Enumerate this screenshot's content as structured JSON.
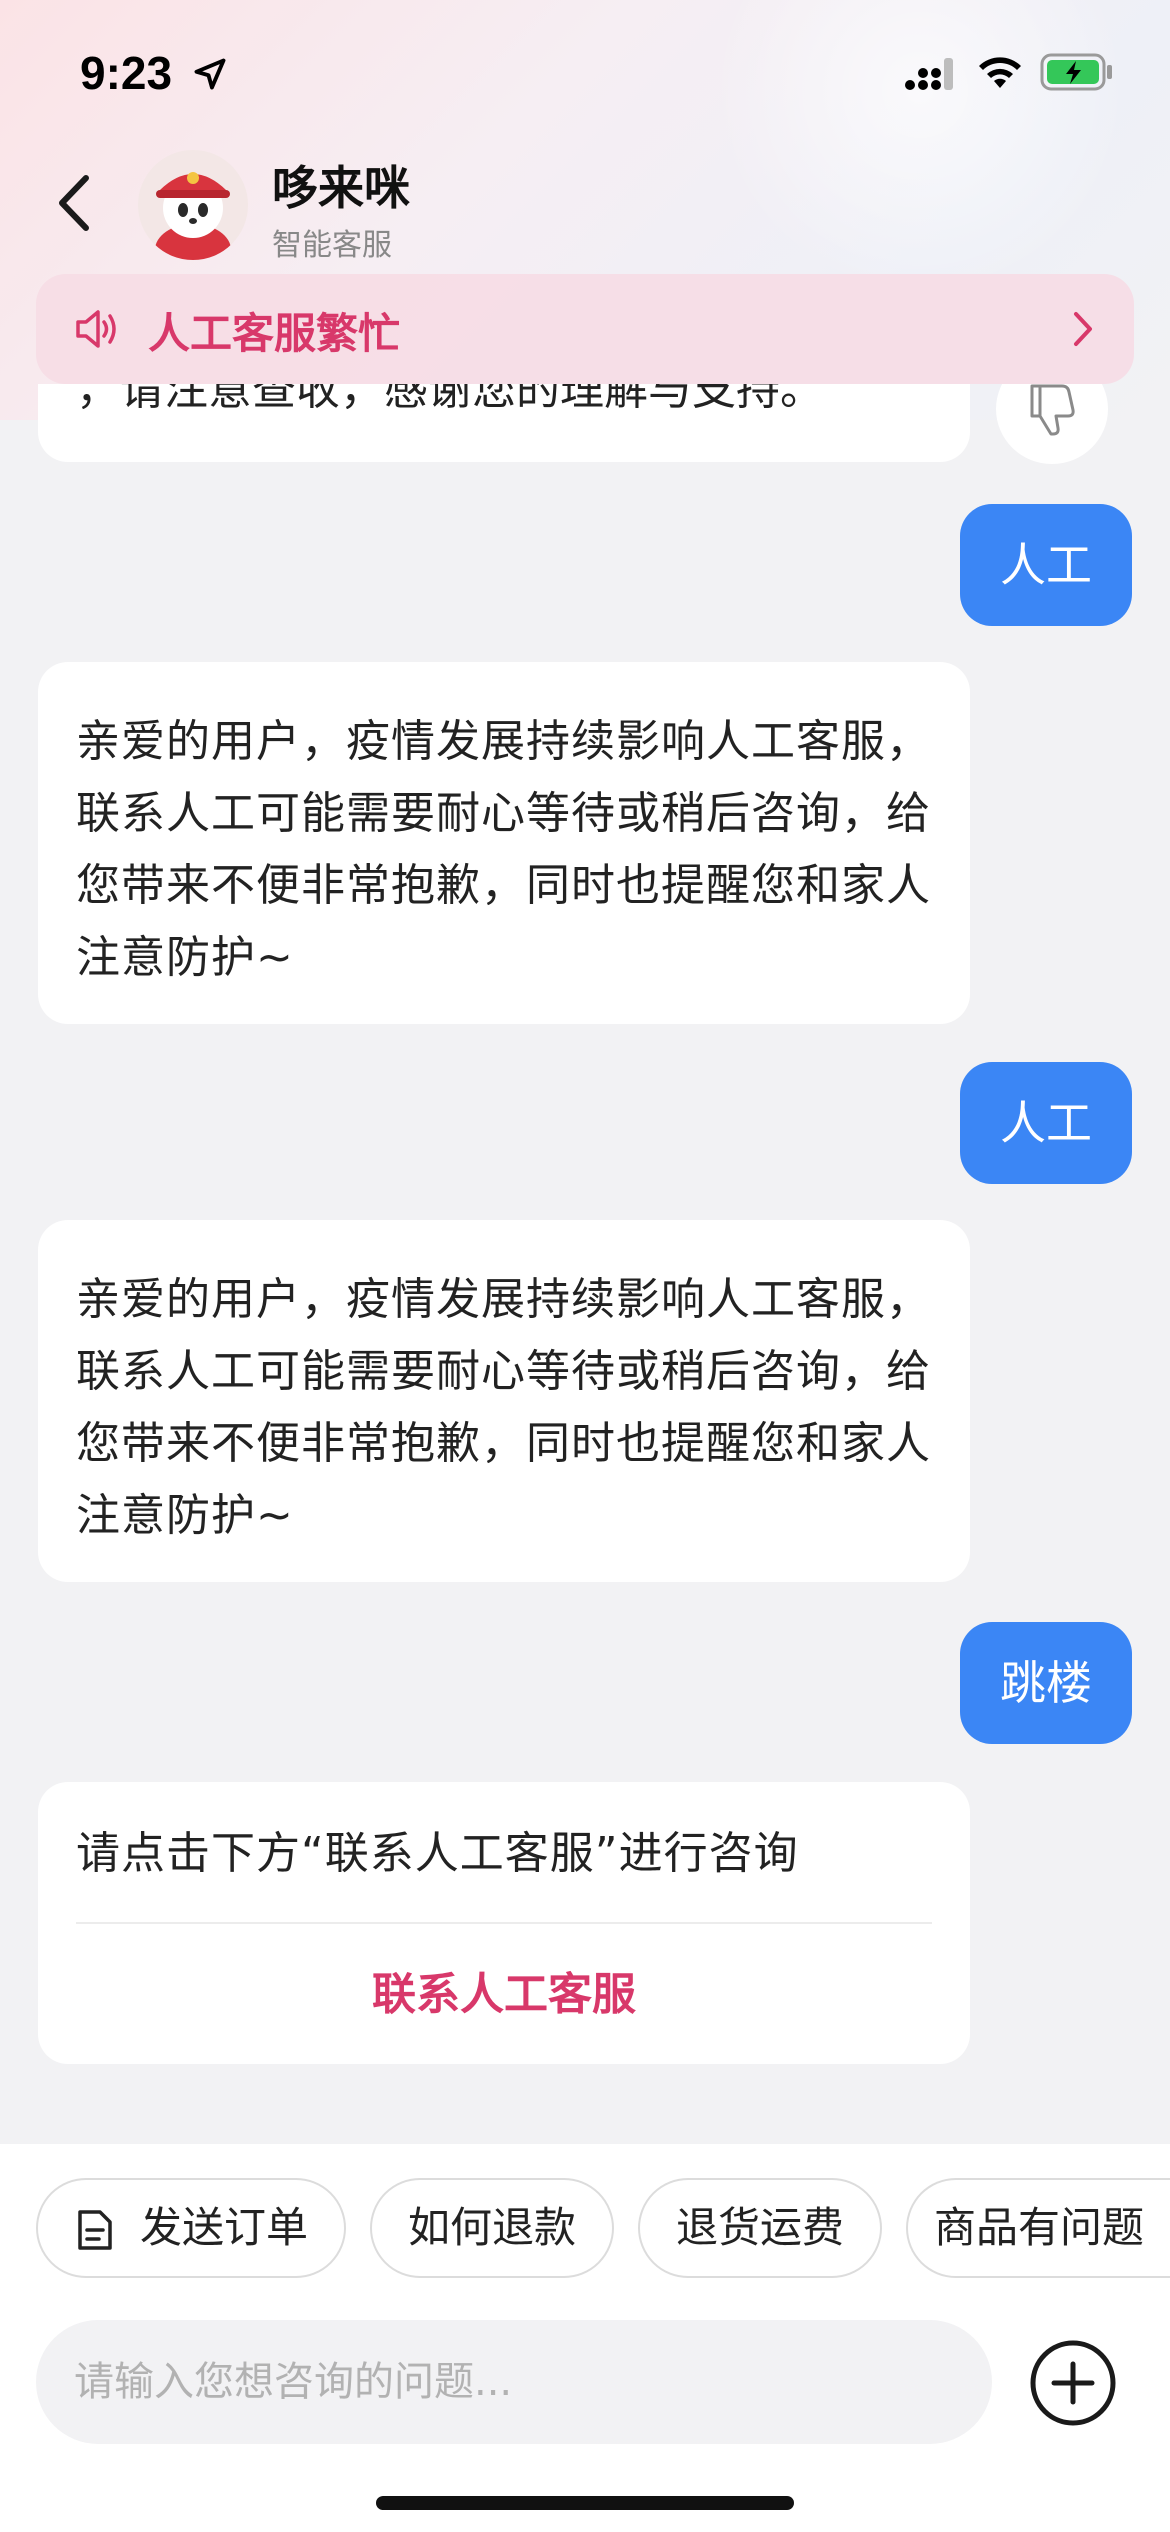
{
  "status_bar": {
    "time": "9:23"
  },
  "header": {
    "bot_name": "哆来咪",
    "bot_subtitle": "智能客服"
  },
  "notice": {
    "text": "人工客服繁忙"
  },
  "messages": {
    "partial_bot": "，请注意查收，感谢您的理解与支持。",
    "user_1": "人工",
    "bot_1": "亲爱的用户，疫情发展持续影响人工客服，联系人工可能需要耐心等待或稍后咨询，给您带来不便非常抱歉，同时也提醒您和家人注意防护~",
    "user_2": "人工",
    "bot_2": "亲爱的用户，疫情发展持续影响人工客服，联系人工可能需要耐心等待或稍后咨询，给您带来不便非常抱歉，同时也提醒您和家人注意防护~",
    "user_3": "跳楼",
    "bot_3": "请点击下方“联系人工客服”进行咨询",
    "bot_3_link": "联系人工客服"
  },
  "quick_replies": [
    "发送订单",
    "如何退款",
    "退货运费",
    "商品有问题"
  ],
  "input": {
    "placeholder": "请输入您想咨询的问题..."
  },
  "colors": {
    "accent_pink": "#d8386a",
    "user_bubble": "#3b86f5",
    "background": "#f2f2f4"
  },
  "icons": {
    "status": [
      "location-arrow-icon",
      "signal-icon",
      "wifi-icon",
      "battery-charging-icon"
    ],
    "header": [
      "back-chevron-icon",
      "bot-avatar"
    ],
    "notice": [
      "speaker-icon",
      "chevron-right-icon"
    ],
    "chat": [
      "thumb-down-icon"
    ],
    "bottom": [
      "document-icon",
      "plus-circle-icon"
    ]
  }
}
